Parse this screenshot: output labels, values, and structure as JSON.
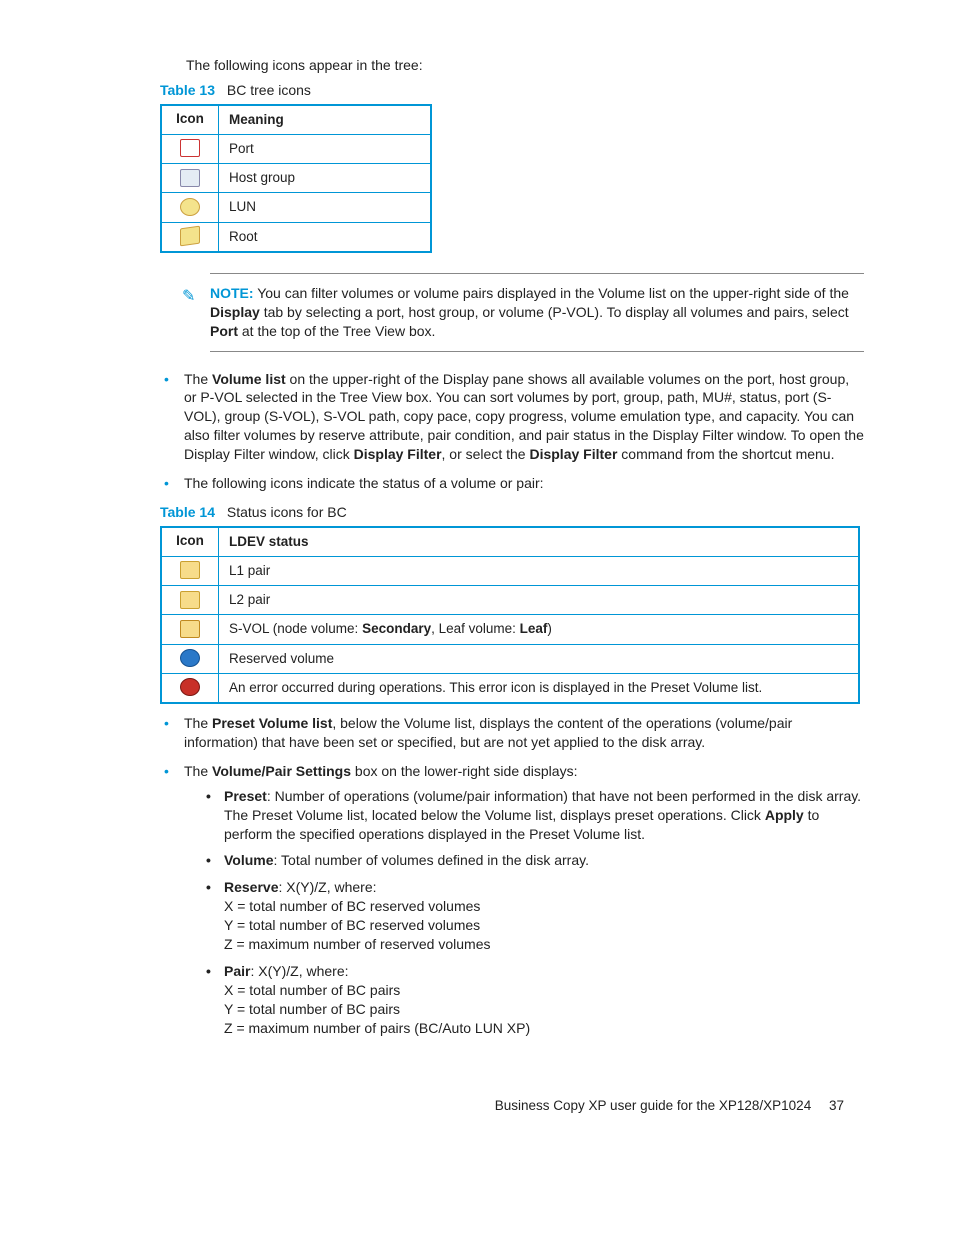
{
  "intro": "The following icons appear in the tree:",
  "table13": {
    "label_num": "Table 13",
    "label_cap": "BC tree icons",
    "headers": [
      "Icon",
      "Meaning"
    ],
    "rows": [
      {
        "icon": "port-icon",
        "meaning": "Port"
      },
      {
        "icon": "host-group-icon",
        "meaning": "Host group"
      },
      {
        "icon": "lun-icon",
        "meaning": "LUN"
      },
      {
        "icon": "root-icon",
        "meaning": "Root"
      }
    ]
  },
  "note": {
    "label": "NOTE:",
    "text_before": "You can filter volumes or volume pairs displayed in the Volume list on the upper-right side of the ",
    "bold1": "Display",
    "text_mid": " tab by selecting a port, host group, or volume (P-VOL). To display all volumes and pairs, select ",
    "bold2": "Port",
    "text_after": " at the top of the Tree View box."
  },
  "bullet_volume_list": {
    "b1": "Volume list",
    "t1": "The ",
    "t2": " on the upper-right of the Display pane shows all available volumes on the port, host group, or P-VOL selected in the Tree View box. You can sort volumes by port, group, path, MU#, status, port (S-VOL), group (S-VOL), S-VOL path, copy pace, copy progress, volume emulation type, and capacity. You can also filter volumes by reserve attribute, pair condition, and pair status in the Display Filter window. To open the Display Filter window, click ",
    "b2": "Display Filter",
    "t3": ", or select the ",
    "b3": "Display Filter",
    "t4": " command from the shortcut menu."
  },
  "bullet_status_intro": "The following icons indicate the status of a volume or pair:",
  "table14": {
    "label_num": "Table 14",
    "label_cap": "Status icons for BC",
    "headers": [
      "Icon",
      "LDEV status"
    ],
    "rows": [
      {
        "icon": "l1-pair-icon",
        "text": "L1 pair"
      },
      {
        "icon": "l2-pair-icon",
        "text": "L2 pair"
      },
      {
        "icon": "svol-icon",
        "pre": "S-VOL (node volume: ",
        "b1": "Secondary",
        "mid": ", Leaf volume: ",
        "b2": "Leaf",
        "post": ")"
      },
      {
        "icon": "reserved-icon",
        "text": "Reserved volume"
      },
      {
        "icon": "error-icon",
        "text": "An error occurred during operations. This error icon is displayed in the Preset Volume list."
      }
    ]
  },
  "bullet_preset": {
    "t1": "The ",
    "b1": "Preset Volume list",
    "t2": ", below the Volume list, displays the content of the operations (volume/pair information) that have been set or specified, but are not yet applied to the disk array."
  },
  "bullet_vpsettings": {
    "t1": "The ",
    "b1": "Volume/Pair Settings",
    "t2": " box on the lower-right side displays:"
  },
  "sub": {
    "preset": {
      "b": "Preset",
      "t1": ": Number of operations (volume/pair information) that have not been performed in the disk array. The Preset Volume list, located below the Volume list, displays preset operations. Click ",
      "b2": "Apply",
      "t2": " to perform the specified operations displayed in the Preset Volume list."
    },
    "volume": {
      "b": "Volume",
      "t": ": Total number of volumes defined in the disk array."
    },
    "reserve": {
      "b": "Reserve",
      "t": ": X(Y)/Z, where:",
      "x": "X = total number of BC reserved volumes",
      "y": "Y = total number of BC reserved volumes",
      "z": "Z = maximum number of reserved volumes"
    },
    "pair": {
      "b": "Pair",
      "t": ": X(Y)/Z, where:",
      "x": "X = total number of BC pairs",
      "y": "Y = total number of BC pairs",
      "z": "Z = maximum number of pairs (BC/Auto LUN XP)"
    }
  },
  "footer": {
    "title": "Business Copy XP user guide for the XP128/XP1024",
    "page": "37"
  }
}
